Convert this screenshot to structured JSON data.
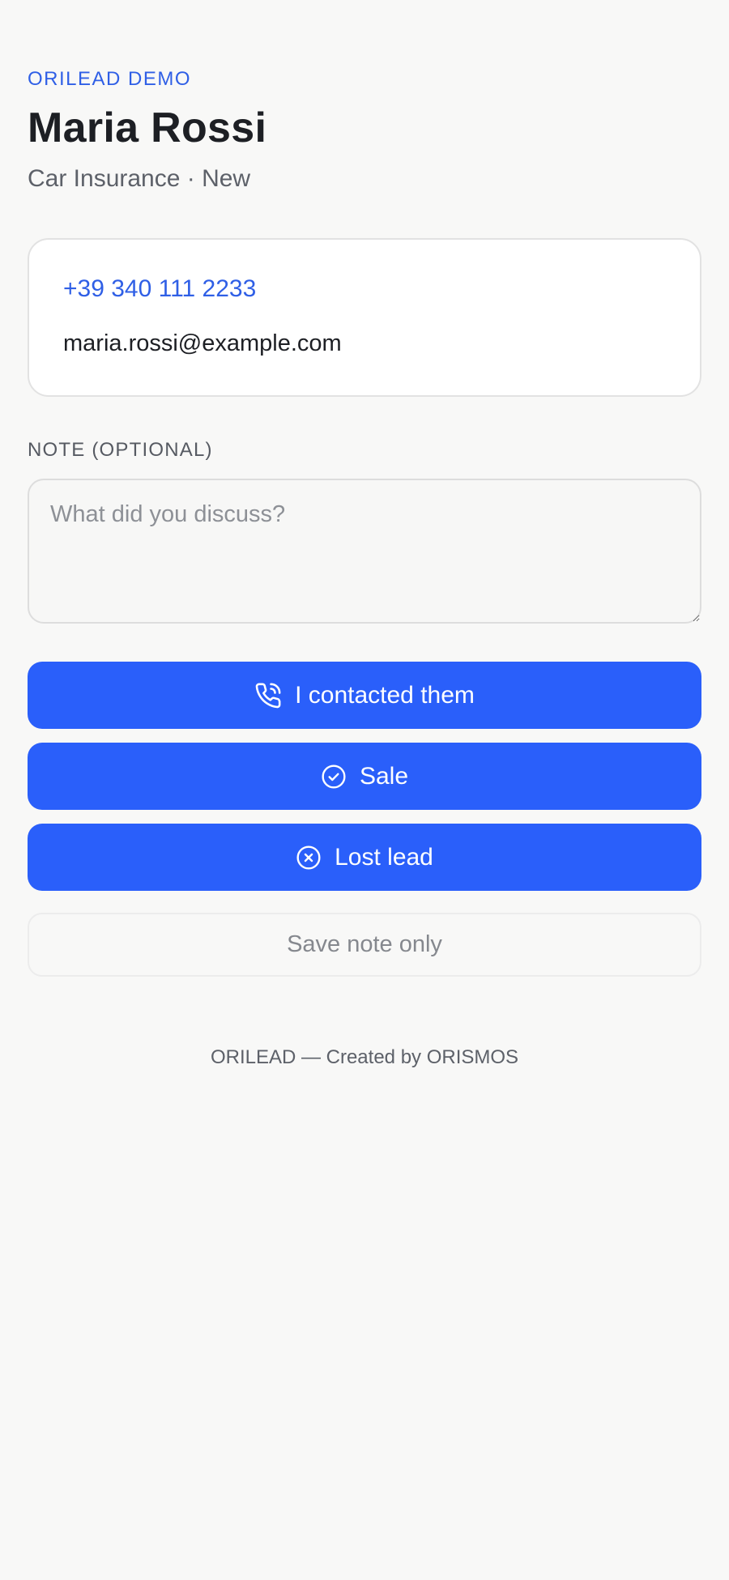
{
  "header": {
    "eyebrow": "ORILEAD DEMO",
    "name": "Maria Rossi",
    "subtitle": "Car Insurance · New"
  },
  "contact": {
    "phone": "+39 340 111 2233",
    "email": "maria.rossi@example.com"
  },
  "note": {
    "label": "NOTE (OPTIONAL)",
    "placeholder": "What did you discuss?",
    "value": ""
  },
  "actions": {
    "contacted_label": "I contacted them",
    "contacted_icon": "phone-call-icon",
    "sale_label": "Sale",
    "sale_icon": "check-circle-icon",
    "lost_label": "Lost lead",
    "lost_icon": "x-circle-icon",
    "save_note_label": "Save note only"
  },
  "footer": {
    "text": "ORILEAD — Created by ORISMOS"
  },
  "colors": {
    "accent": "#2a5ffa",
    "link": "#2f5fe6",
    "background": "#f8f8f7",
    "text": "#1d1f24",
    "muted": "#5d6169"
  }
}
